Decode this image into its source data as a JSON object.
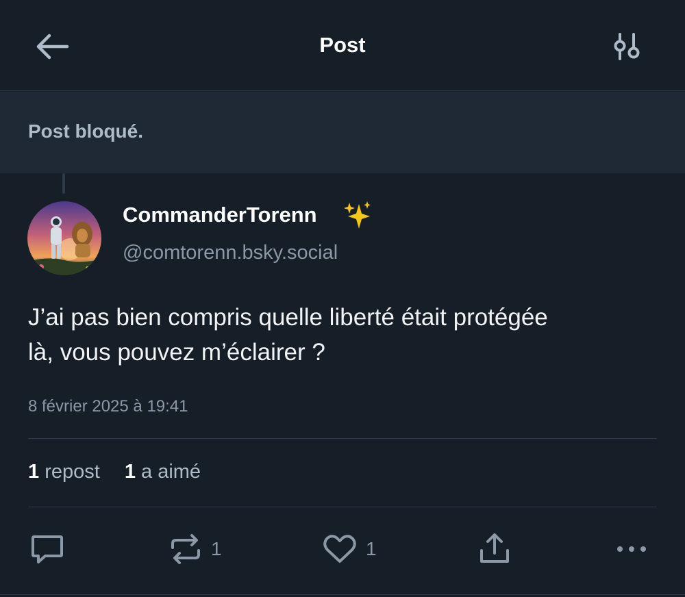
{
  "header": {
    "title": "Post"
  },
  "blocked_notice": "Post bloqué.",
  "post": {
    "author_name": "CommanderTorenn",
    "handle": "@comtorenn.bsky.social",
    "text_line1": "J’ai pas bien compris quelle liberté était protégée",
    "text_line2": "là, vous pouvez m’éclairer ?",
    "timestamp": "8 février 2025 à 19:41",
    "repost_count": "1",
    "repost_label": "repost",
    "like_count": "1",
    "like_label": "a aimé"
  },
  "actions": {
    "reply_count": "",
    "repost_count": "1",
    "like_count": "1"
  },
  "icons": {
    "back": "arrow-left-icon",
    "settings": "sliders-icon",
    "sparkle": "sparkles-icon",
    "reply": "speech-bubble-icon",
    "repost": "repost-icon",
    "like": "heart-icon",
    "share": "share-icon",
    "more": "ellipsis-icon"
  },
  "colors": {
    "background": "#161e27",
    "blocked_background": "#1e2935",
    "muted_text": "#8b98a8",
    "sparkle": "#f5c518"
  }
}
